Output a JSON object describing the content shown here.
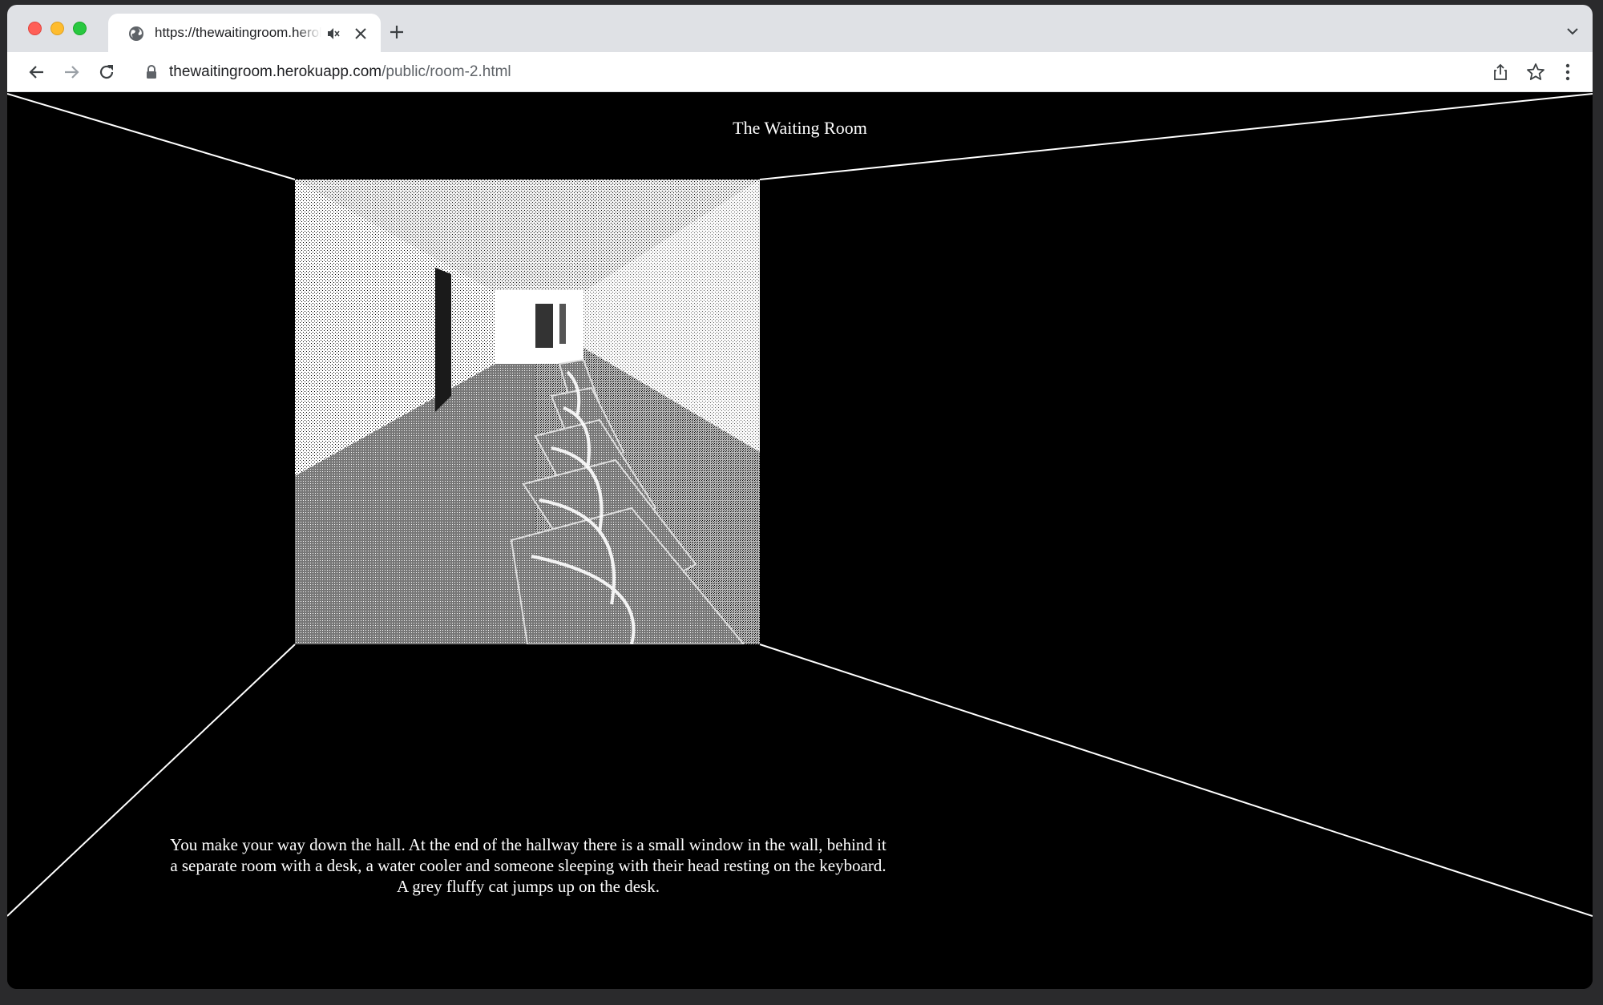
{
  "browser": {
    "tab": {
      "title": "https://thewaitingroom.herokuapp.com/public/room-2.html",
      "favicon": "globe-icon",
      "muted": true
    },
    "url_host": "thewaitingroom.herokuapp.com",
    "url_path": "/public/room-2.html",
    "icons": {
      "back": "arrow-left-icon",
      "forward": "arrow-right-icon",
      "reload": "reload-icon",
      "lock": "lock-icon",
      "share": "share-icon",
      "bookmark": "star-icon",
      "menu": "kebab-menu-icon",
      "new_tab": "plus-icon",
      "tab_search": "chevron-down-icon"
    }
  },
  "page": {
    "title": "The Waiting Room",
    "narration": "You make your way down the hall. At the end of the hallway there is a small window in the wall, behind it a separate room with a desk, a water cooler and someone sleeping with their head resting on the keyboard. A grey fluffy cat jumps up on the desk.",
    "background_color": "#000000",
    "line_color": "#ffffff"
  }
}
